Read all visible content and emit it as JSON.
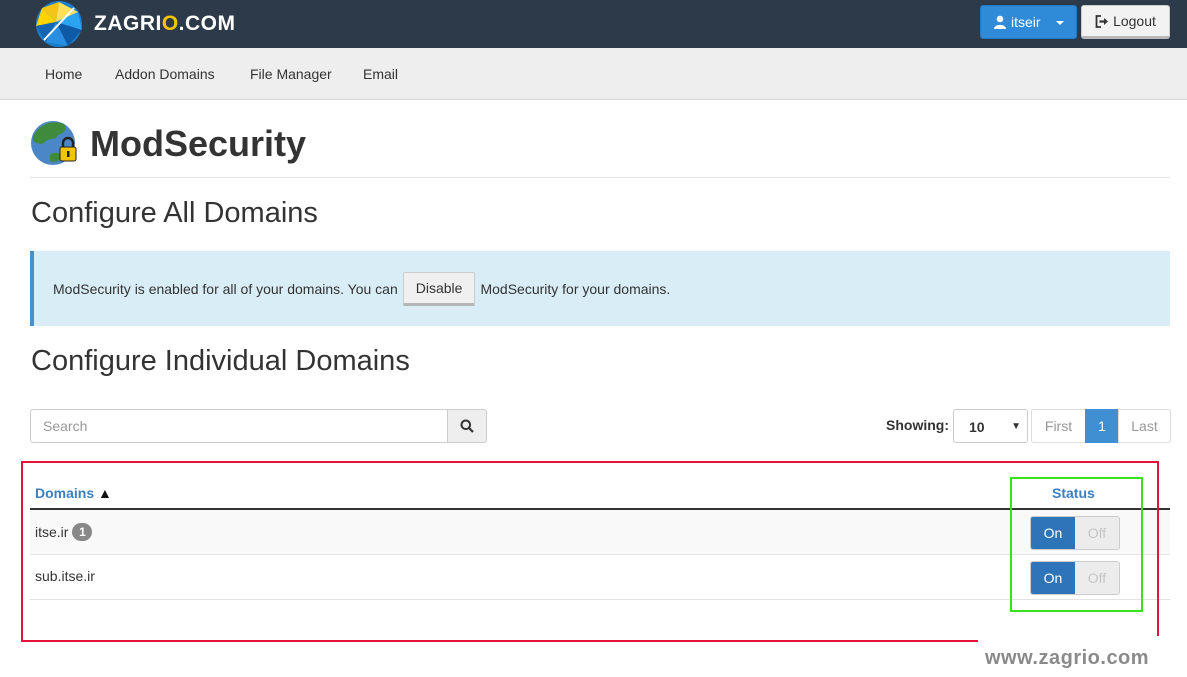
{
  "header": {
    "brand_prefix": "ZAGRI",
    "brand_accent": "O",
    "brand_suffix": ".COM",
    "user_label": "itseir",
    "logout_label": "Logout"
  },
  "nav": {
    "items": [
      {
        "label": "Home"
      },
      {
        "label": "Addon Domains"
      },
      {
        "label": "File Manager"
      },
      {
        "label": "Email"
      }
    ]
  },
  "page": {
    "title": "ModSecurity",
    "section_all": "Configure All Domains",
    "info_before": "ModSecurity is enabled for all of your domains. You can",
    "disable_label": "Disable",
    "info_after": "ModSecurity for your domains.",
    "section_individual": "Configure Individual Domains"
  },
  "controls": {
    "search_placeholder": "Search",
    "showing_label": "Showing:",
    "page_size": "10",
    "pager_first": "First",
    "pager_current": "1",
    "pager_last": "Last"
  },
  "table": {
    "col_domains": "Domains",
    "sort_indicator": "▲",
    "col_status": "Status",
    "rows": [
      {
        "domain": "itse.ir",
        "badge": "1",
        "on_label": "On",
        "off_label": "Off",
        "status": "On"
      },
      {
        "domain": "sub.itse.ir",
        "on_label": "On",
        "off_label": "Off",
        "status": "On"
      }
    ]
  },
  "watermark": "www.zagrio.com",
  "colors": {
    "topbar": "#2d3a4a",
    "primary": "#2f8ad8",
    "toggle_on": "#2d75b8",
    "info_bg": "#d9edf7",
    "link": "#3a7fc1",
    "annotation_red": "#e5123c",
    "annotation_green": "#38e21c"
  },
  "icons": {
    "user": "user-icon",
    "logout": "logout-icon",
    "search": "search-icon",
    "modsecurity": "globe-lock-icon"
  }
}
